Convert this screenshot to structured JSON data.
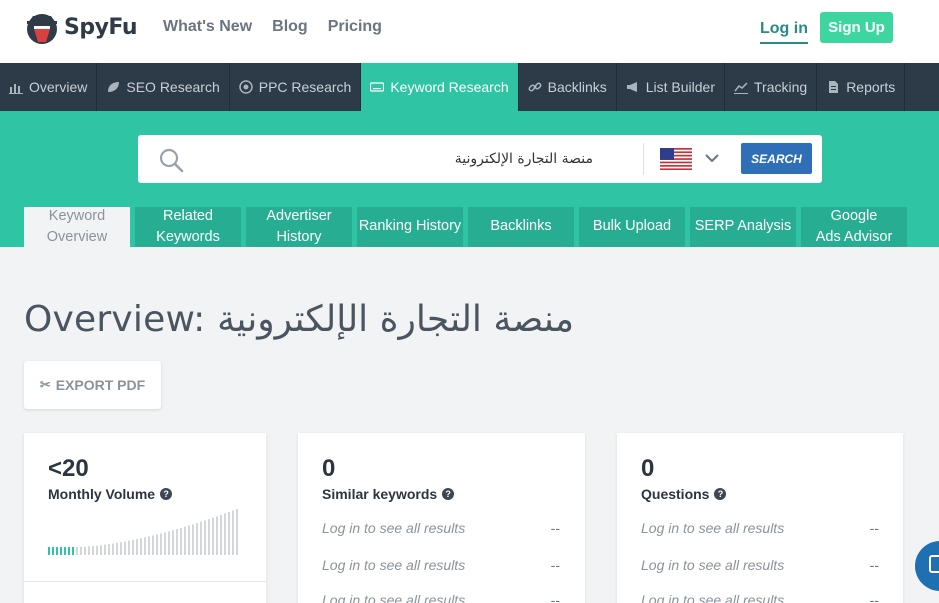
{
  "brand": {
    "name": "SpyFu"
  },
  "topnav": [
    {
      "label": "What's New"
    },
    {
      "label": "Blog"
    },
    {
      "label": "Pricing"
    }
  ],
  "auth": {
    "login_label": "Log in",
    "signup_label": "Sign Up"
  },
  "mainnav": [
    {
      "label": "Overview",
      "icon": "bar-chart-icon",
      "active": false
    },
    {
      "label": "SEO Research",
      "icon": "leaf-icon",
      "active": false
    },
    {
      "label": "PPC Research",
      "icon": "target-icon",
      "active": false
    },
    {
      "label": "Keyword Research",
      "icon": "keyboard-icon",
      "active": true
    },
    {
      "label": "Backlinks",
      "icon": "link-icon",
      "active": false
    },
    {
      "label": "List Builder",
      "icon": "megaphone-icon",
      "active": false
    },
    {
      "label": "Tracking",
      "icon": "line-chart-icon",
      "active": false
    },
    {
      "label": "Reports",
      "icon": "document-icon",
      "active": false
    }
  ],
  "search": {
    "value": "منصة التجارة الإلكترونية",
    "country_flag": "us-flag-icon",
    "button_label": "SEARCH"
  },
  "subtabs": [
    {
      "label": "Keyword Overview",
      "active": true
    },
    {
      "label": "Related Keywords",
      "active": false
    },
    {
      "label": "Advertiser History",
      "active": false
    },
    {
      "label": "Ranking History",
      "active": false
    },
    {
      "label": "Backlinks",
      "active": false
    },
    {
      "label": "Bulk Upload",
      "active": false
    },
    {
      "label": "SERP Analysis",
      "active": false
    },
    {
      "label": "Google Ads Advisor",
      "active": false
    }
  ],
  "page": {
    "title": "Overview: منصة التجارة الإلكترونية",
    "export_label": "EXPORT PDF"
  },
  "cards": {
    "volume": {
      "value": "<20",
      "label": "Monthly Volume",
      "help": "?"
    },
    "similar": {
      "value": "0",
      "label": "Similar keywords",
      "help": "?",
      "rows": [
        {
          "text": "Log in to see all results",
          "value": "--"
        },
        {
          "text": "Log in to see all results",
          "value": "--"
        },
        {
          "text": "Log in to see all results",
          "value": "--"
        }
      ]
    },
    "questions": {
      "value": "0",
      "label": "Questions",
      "help": "?",
      "rows": [
        {
          "text": "Log in to see all results",
          "value": "--"
        },
        {
          "text": "Log in to see all results",
          "value": "--"
        },
        {
          "text": "Log in to see all results",
          "value": "--"
        }
      ]
    }
  },
  "colors": {
    "teal": "#2fc5a4",
    "teal_dark": "#27ad91",
    "nav_dark": "#2d3a47",
    "search_blue": "#2f6fb8",
    "signup_green": "#3dd6a0"
  }
}
